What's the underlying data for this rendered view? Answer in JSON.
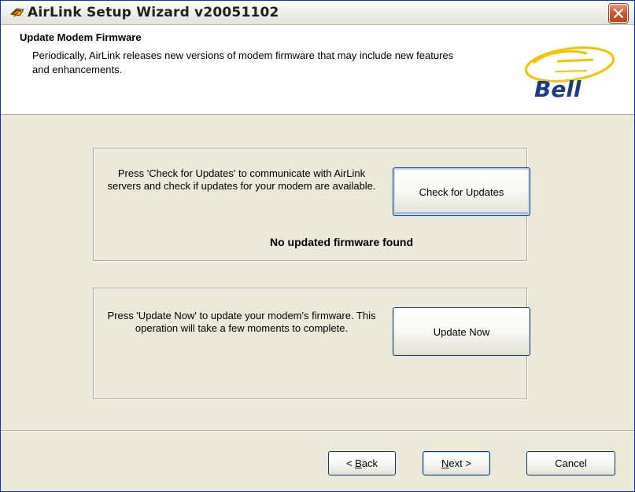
{
  "window": {
    "title": "AirLink Setup Wizard v20051102",
    "title_icon": "airlink-icon",
    "close_icon": "close-icon"
  },
  "header": {
    "title": "Update Modem Firmware",
    "description": "Periodically, AirLink releases new versions of modem firmware that may include new features and enhancements.",
    "logo_text": "Bell"
  },
  "check_section": {
    "instruction": "Press 'Check for Updates' to communicate with AirLink servers and check if updates for your modem are available.",
    "button_label": "Check for Updates",
    "status": "No updated firmware found"
  },
  "update_section": {
    "instruction": "Press 'Update Now' to update your modem's firmware. This operation will take a few moments to complete.",
    "button_label": "Update Now"
  },
  "footer": {
    "back_label": "< Back",
    "back_accel": "B",
    "next_label": "Next >",
    "next_accel": "N",
    "cancel_label": "Cancel"
  },
  "colors": {
    "accent": "#003c74",
    "logo_yellow": "#f5c400",
    "logo_blue": "#1a3a8a"
  }
}
